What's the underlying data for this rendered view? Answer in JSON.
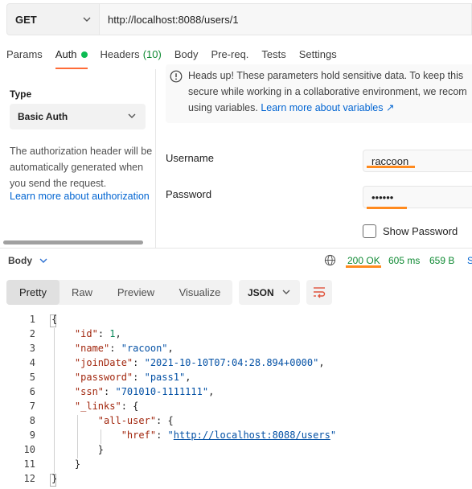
{
  "request": {
    "method": "GET",
    "url": "http://localhost:8088/users/1"
  },
  "tabs": {
    "params": "Params",
    "auth": "Auth",
    "headers": "Headers",
    "headers_count": "(10)",
    "body": "Body",
    "prereq": "Pre-req.",
    "tests": "Tests",
    "settings": "Settings"
  },
  "auth": {
    "type_label": "Type",
    "type_value": "Basic Auth",
    "description": "The authorization header will be automatically generated when you send the request.",
    "learn_link": "Learn more about authorization",
    "notice_line1": "Heads up! These parameters hold sensitive data. To keep this",
    "notice_line2": "secure while working in a collaborative environment, we recom",
    "notice_line3_prefix": "using variables. ",
    "notice_link": "Learn more about variables ↗",
    "username_label": "Username",
    "username_value": "raccoon",
    "password_label": "Password",
    "password_value": "••••••",
    "show_password": "Show Password"
  },
  "response": {
    "section": "Body",
    "status": "200 OK",
    "time": "605 ms",
    "size": "659 B",
    "views": [
      "Pretty",
      "Raw",
      "Preview",
      "Visualize"
    ],
    "format": "JSON"
  },
  "code_lines": [
    "1",
    "2",
    "3",
    "4",
    "5",
    "6",
    "7",
    "8",
    "9",
    "10",
    "11",
    "12"
  ],
  "code": {
    "open": "{",
    "id_key": "\"id\"",
    "id_val": "1",
    "name_key": "\"name\"",
    "name_val": "\"racoon\"",
    "join_key": "\"joinDate\"",
    "join_val": "\"2021-10-10T07:04:28.894+0000\"",
    "pw_key": "\"password\"",
    "pw_val": "\"pass1\"",
    "ssn_key": "\"ssn\"",
    "ssn_val": "\"701010-1111111\"",
    "links_key": "\"_links\"",
    "all_user_key": "\"all-user\"",
    "href_key": "\"href\"",
    "href_val": "http://localhost:8088/users",
    "close": "}"
  },
  "colors": {
    "accent": "#ff6c37",
    "status_green": "#0f8a33",
    "link_blue": "#0265d2"
  },
  "icons": [
    "chevron-down-icon",
    "info-icon",
    "globe-icon",
    "wrap-lines-icon"
  ]
}
